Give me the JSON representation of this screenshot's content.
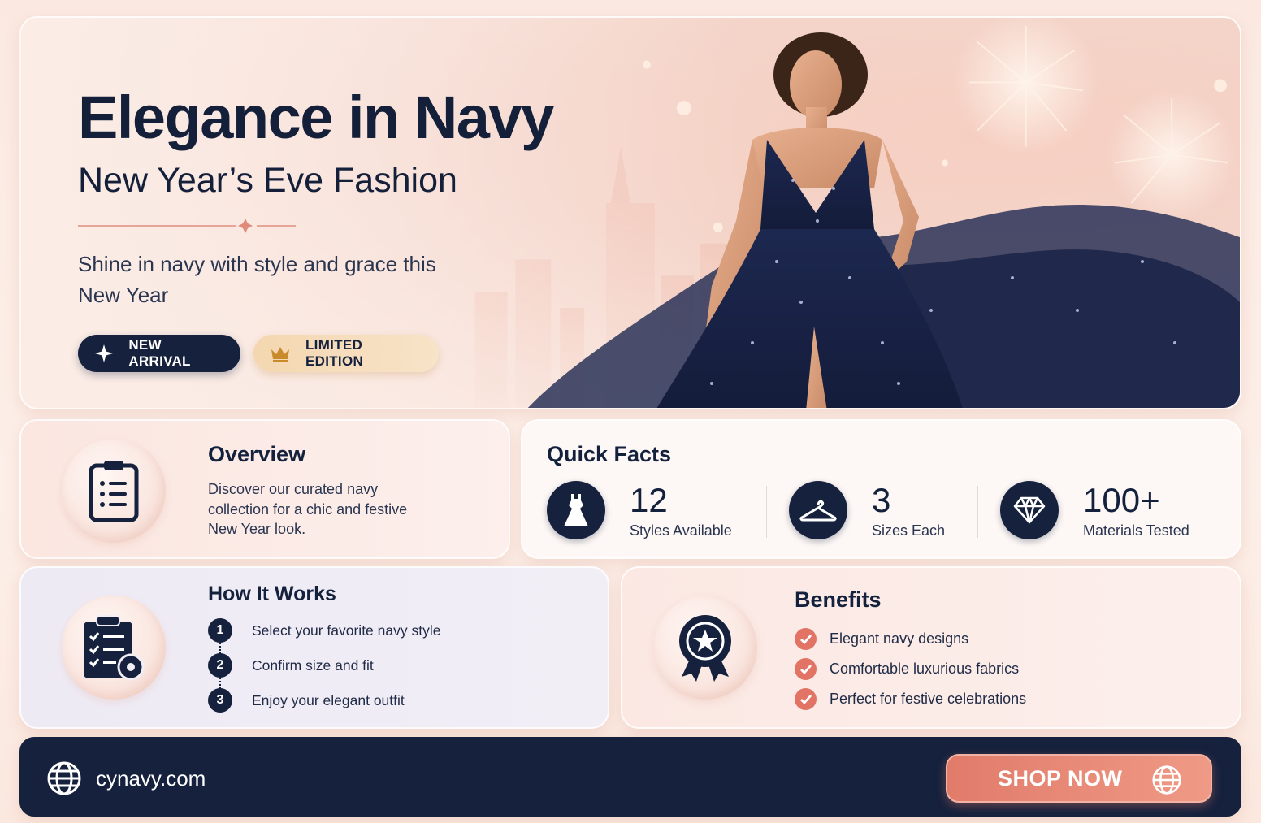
{
  "hero": {
    "title": "Elegance in Navy",
    "subtitle": "New Year’s Eve Fashion",
    "tagline": "Shine in navy with style and grace this New Year",
    "badges": [
      {
        "label": "NEW ARRIVAL",
        "icon": "sparkle-icon"
      },
      {
        "label": "LIMITED EDITION",
        "icon": "crown-icon"
      }
    ],
    "image": "model-in-navy-sequin-gown"
  },
  "overview": {
    "title": "Overview",
    "text": "Discover our curated navy collection for a chic and festive New Year look.",
    "icon": "clipboard-list-icon"
  },
  "quick_facts": {
    "title": "Quick Facts",
    "items": [
      {
        "value": "12",
        "label": "Styles Available",
        "icon": "dress-icon"
      },
      {
        "value": "3",
        "label": "Sizes Each",
        "icon": "hanger-icon"
      },
      {
        "value": "100+",
        "label": "Materials Tested",
        "icon": "diamond-icon"
      }
    ]
  },
  "how_it_works": {
    "title": "How It Works",
    "icon": "clipboard-check-gear-icon",
    "steps": [
      {
        "num": "1",
        "text": "Select your favorite navy style"
      },
      {
        "num": "2",
        "text": "Confirm size and fit"
      },
      {
        "num": "3",
        "text": "Enjoy your elegant outfit"
      }
    ]
  },
  "benefits": {
    "title": "Benefits",
    "icon": "award-ribbon-icon",
    "items": [
      "Elegant navy designs",
      "Comfortable luxurious fabrics",
      "Perfect for festive celebrations"
    ]
  },
  "footer": {
    "url": "cynavy.com",
    "cta": "SHOP NOW"
  },
  "colors": {
    "navy": "#15213d",
    "coral": "#e27466",
    "blush": "#fbe9e1",
    "gold": "#f4d7b0"
  }
}
